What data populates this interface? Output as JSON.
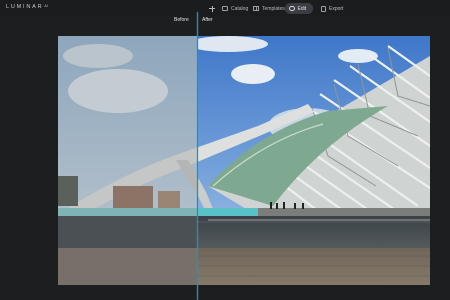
{
  "app": {
    "logo_text": "LUMINAR",
    "logo_superscript": "AI"
  },
  "nav": {
    "add_icon": "plus-icon",
    "items": [
      {
        "label": "Catalog",
        "icon": "catalog-icon",
        "active": false
      },
      {
        "label": "Templates",
        "icon": "templates-icon",
        "active": false
      },
      {
        "label": "Edit",
        "icon": "edit-icon",
        "active": true
      },
      {
        "label": "Export",
        "icon": "export-icon",
        "active": false
      }
    ]
  },
  "compare": {
    "before_label": "Before",
    "after_label": "After"
  },
  "colors": {
    "background": "#1d1e20",
    "active_tab": "#3a3d42",
    "divider": "#1f8fb0",
    "sky": "#5f8fd4"
  }
}
